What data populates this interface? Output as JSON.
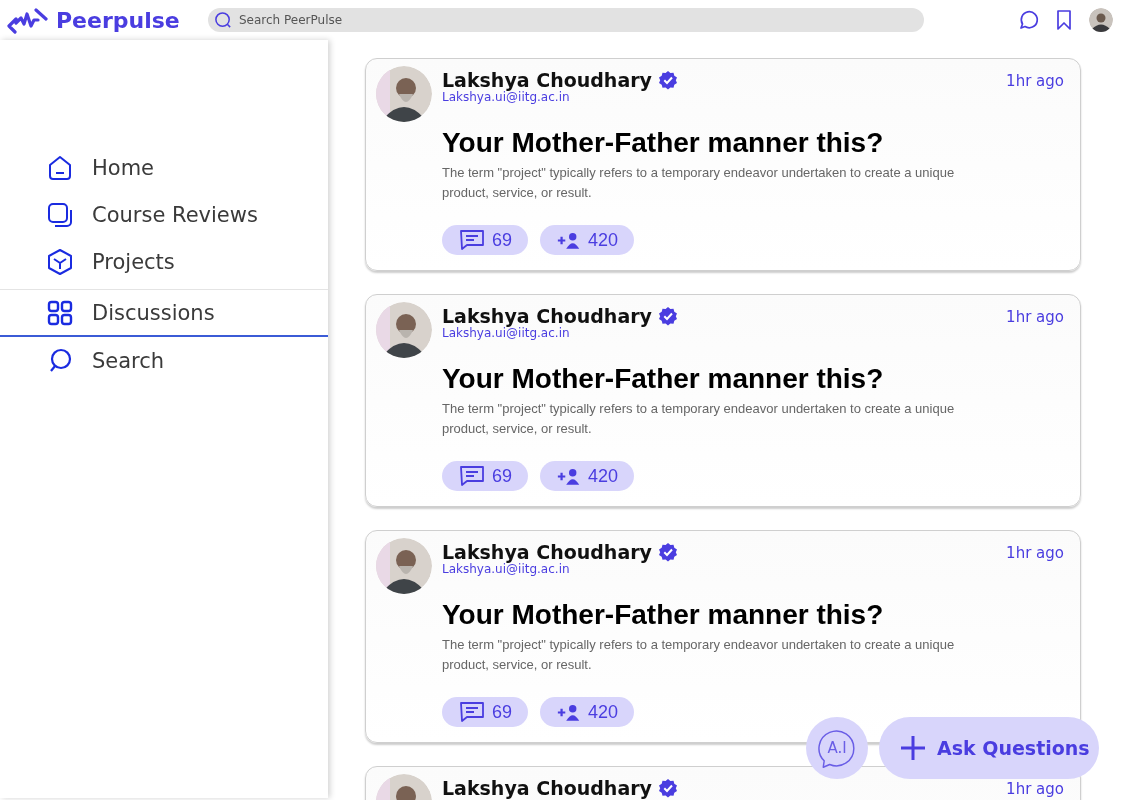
{
  "brand": {
    "name": "Peerpulse"
  },
  "search": {
    "placeholder": "Search PeerPulse"
  },
  "sidebar": {
    "items": [
      {
        "label": "Home",
        "selected": false
      },
      {
        "label": "Course Reviews",
        "selected": false
      },
      {
        "label": "Projects",
        "selected": false
      },
      {
        "label": "Discussions",
        "selected": true
      },
      {
        "label": "Search",
        "selected": false
      }
    ]
  },
  "posts": [
    {
      "author": "Lakshya Choudhary",
      "verified": true,
      "email": "Lakshya.ui@iitg.ac.in",
      "time": "1hr ago",
      "title": "Your Mother-Father manner this?",
      "body": "The term \"project\" typically refers to a temporary endeavor undertaken to create a unique product, service, or result.",
      "comments": "69",
      "followers": "420"
    },
    {
      "author": "Lakshya Choudhary",
      "verified": true,
      "email": "Lakshya.ui@iitg.ac.in",
      "time": "1hr ago",
      "title": "Your Mother-Father manner this?",
      "body": "The term \"project\" typically refers to a temporary endeavor undertaken to create a unique product, service, or result.",
      "comments": "69",
      "followers": "420"
    },
    {
      "author": "Lakshya Choudhary",
      "verified": true,
      "email": "Lakshya.ui@iitg.ac.in",
      "time": "1hr ago",
      "title": "Your Mother-Father manner this?",
      "body": "The term \"project\" typically refers to a temporary endeavor undertaken to create a unique product, service, or result.",
      "comments": "69",
      "followers": "420"
    },
    {
      "author": "Lakshya Choudhary",
      "verified": true,
      "time": "1hr ago"
    }
  ],
  "ai_button": {
    "label": "A.I"
  },
  "ask_button": {
    "label": "Ask Questions"
  }
}
